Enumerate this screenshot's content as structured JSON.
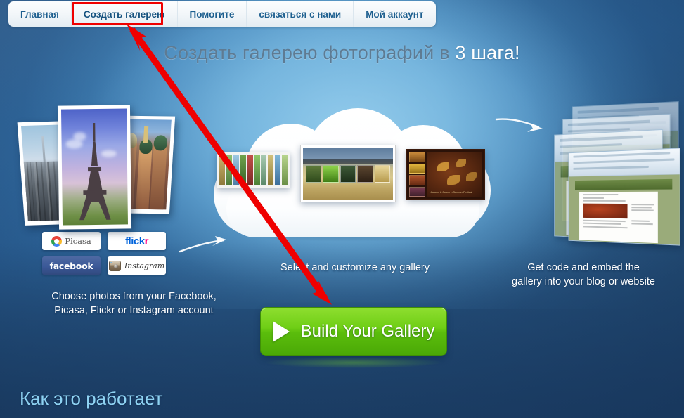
{
  "nav": {
    "items": [
      {
        "label": "Главная",
        "selected": false
      },
      {
        "label": "Создать галерею",
        "selected": true
      },
      {
        "label": "Помогите",
        "selected": false
      },
      {
        "label": "связаться с нами",
        "selected": false
      },
      {
        "label": "Мой аккаунт",
        "selected": false
      }
    ],
    "highlight_color": "#ef0000"
  },
  "headline": {
    "part1": "Создать галерею фотографий в ",
    "part2": "3 шага!",
    "dim_color": "#5e7b93",
    "highlight_color": "#ffffff"
  },
  "badges": {
    "picasa": "Picasa",
    "flickr_1": "flick",
    "flickr_2": "r",
    "facebook": "facebook",
    "instagram": "Instagram"
  },
  "captions": {
    "left_line1": "Choose photos from your Facebook,",
    "left_line2": "Picasa, Flickr or Instagram account",
    "middle": "Select and customize any gallery",
    "right_line1": "Get code and embed the",
    "right_line2": "gallery into your blog or website"
  },
  "cta": {
    "label": "Build Your Gallery",
    "icon": "play-triangle-icon",
    "color": "#6fce16"
  },
  "footer": {
    "how_it_works": "Как это работает",
    "color": "#8ed2f2"
  },
  "annotation": {
    "type": "double-headed-arrow",
    "color": "#ef0000",
    "from": "Создать галерею",
    "to": "Build Your Gallery"
  },
  "gallery_previews": [
    {
      "name": "carousel-gallery-preview"
    },
    {
      "name": "wheat-slider-gallery-preview"
    },
    {
      "name": "autumn-gallery-preview",
      "caption": "Autumn & Colors in Summer Festival"
    }
  ],
  "photos": [
    {
      "name": "new-york-skyline-photo"
    },
    {
      "name": "eiffel-tower-photo"
    },
    {
      "name": "saint-basil-cathedral-photo"
    }
  ],
  "background": {
    "top": "#3c6d9e",
    "bottom": "#20416a",
    "glow": "#84c2e7"
  }
}
